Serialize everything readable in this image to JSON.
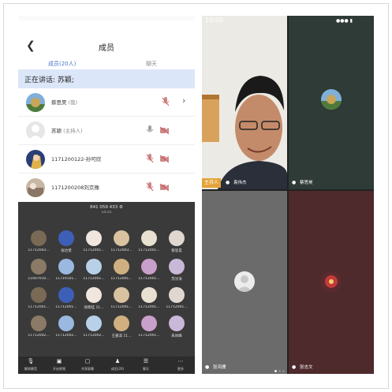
{
  "members_screen": {
    "title": "成员",
    "back_icon": "chevron-left-icon",
    "tabs": [
      {
        "label": "成员(20人)",
        "active": true
      },
      {
        "label": "聊天",
        "active": false
      }
    ],
    "speaking_label": "正在讲话: 苏颖;",
    "rows": [
      {
        "name": "蔡思昊",
        "role": "(我)",
        "avatar": "landscape-avatar",
        "mic": "muted",
        "camera": "none",
        "expand": true
      },
      {
        "name": "苏颖",
        "role": "(主持人)",
        "avatar": "default-avatar",
        "mic": "on",
        "camera": "off"
      },
      {
        "name": "1171200122-孙可欣",
        "role": "",
        "avatar": "anime-avatar",
        "mic": "muted",
        "camera": "off"
      },
      {
        "name": "1171200208刘京豫",
        "role": "",
        "avatar": "photo-avatar",
        "mic": "muted",
        "camera": "off"
      }
    ],
    "accent_color": "#4a73c9"
  },
  "gallery_screen": {
    "meeting_id": "841 059 433 ⚙",
    "time": "14:25",
    "participants": [
      "11712003...",
      "张达斐",
      "11712001...",
      "11712003...",
      "11712001...",
      "蔡思昊",
      "11607010...",
      "11719101...",
      "11712001...",
      "11712001...",
      "11712001...",
      "苏汶涛",
      "11712001...",
      "11712001...",
      "徐筱桂 11...",
      "11712001...",
      "11712001...",
      "11712001...",
      "11712002...",
      "11712002...",
      "11712002...",
      "王嘉淇 11...",
      "11712001...",
      "朱尚峰"
    ],
    "page_dots": 2,
    "toolbar": [
      {
        "label": "解除静音",
        "icon": "mic-muted-icon"
      },
      {
        "label": "开启视频",
        "icon": "camera-off-icon"
      },
      {
        "label": "共享屏幕",
        "icon": "share-screen-icon"
      },
      {
        "label": "成员(20)",
        "icon": "members-icon"
      },
      {
        "label": "聊天",
        "icon": "chat-icon"
      },
      {
        "label": "更多",
        "icon": "more-icon"
      }
    ]
  },
  "video_screen": {
    "status_time": "10:00",
    "tiles": [
      {
        "name": "袁伟杰",
        "badge": "主持人",
        "type": "camera"
      },
      {
        "name": "蔡思昊",
        "badge": "",
        "type": "avatar"
      },
      {
        "name": "张鸿儒",
        "badge": "",
        "type": "default-avatar"
      },
      {
        "name": "张志文",
        "badge": "",
        "type": "avatar"
      }
    ],
    "page_dots": 3
  }
}
